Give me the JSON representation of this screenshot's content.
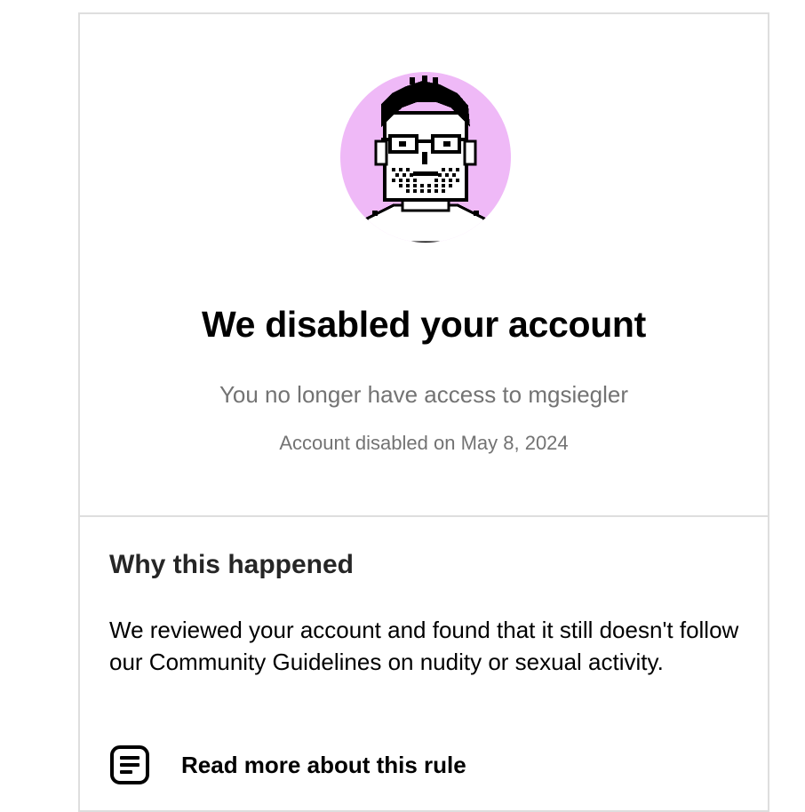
{
  "header": {
    "title": "We disabled your account",
    "subtitle": "You no longer have access to mgsiegler",
    "disabled_date": "Account disabled on May 8, 2024"
  },
  "avatar": {
    "icon": "pixel-portrait-avatar",
    "background": "#efb9f7"
  },
  "reason": {
    "heading": "Why this happened",
    "body": "We reviewed your account and found that it still doesn't follow our Community Guidelines on nudity or sexual activity."
  },
  "rule_link": {
    "icon": "document-lines-icon",
    "label": "Read more about this rule"
  }
}
